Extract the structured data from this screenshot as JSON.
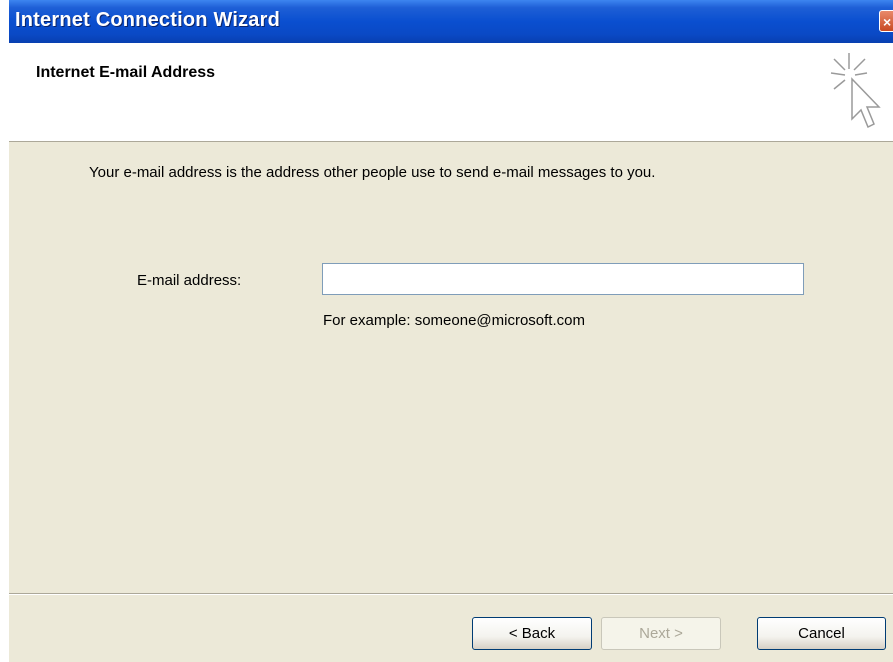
{
  "window": {
    "title": "Internet Connection Wizard",
    "close_glyph": "×"
  },
  "header": {
    "title": "Internet E-mail Address",
    "icon": "wizard-cursor-icon"
  },
  "main": {
    "intro": "Your e-mail address is the address other people use to send e-mail messages to you.",
    "email_label": "E-mail address:",
    "email_value": "",
    "example": "For example: someone@microsoft.com"
  },
  "buttons": {
    "back": "< Back",
    "next": "Next >",
    "cancel": "Cancel"
  },
  "colors": {
    "titlebar": "#0a4fd0",
    "dialog_bg": "#ece9d8",
    "header_bg": "#ffffff"
  }
}
